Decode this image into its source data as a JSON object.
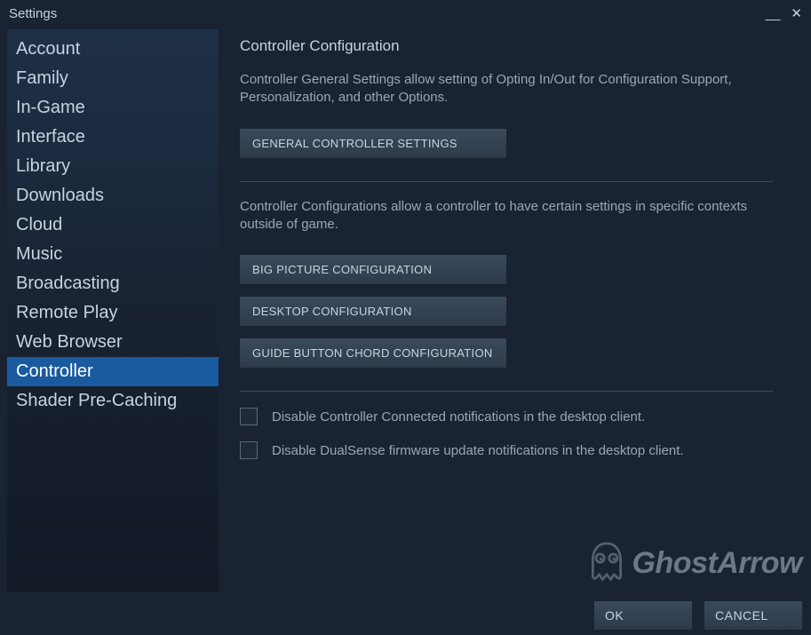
{
  "window": {
    "title": "Settings"
  },
  "sidebar": {
    "items": [
      {
        "label": "Account",
        "active": false
      },
      {
        "label": "Family",
        "active": false
      },
      {
        "label": "In-Game",
        "active": false
      },
      {
        "label": "Interface",
        "active": false
      },
      {
        "label": "Library",
        "active": false
      },
      {
        "label": "Downloads",
        "active": false
      },
      {
        "label": "Cloud",
        "active": false
      },
      {
        "label": "Music",
        "active": false
      },
      {
        "label": "Broadcasting",
        "active": false
      },
      {
        "label": "Remote Play",
        "active": false
      },
      {
        "label": "Web Browser",
        "active": false
      },
      {
        "label": "Controller",
        "active": true
      },
      {
        "label": "Shader Pre-Caching",
        "active": false
      }
    ]
  },
  "content": {
    "title": "Controller Configuration",
    "desc1": "Controller General Settings allow setting of Opting In/Out for Configuration Support, Personalization, and other Options.",
    "btn_general": "GENERAL CONTROLLER SETTINGS",
    "desc2": "Controller Configurations allow a controller to have certain settings in specific contexts outside of game.",
    "btn_bigpicture": "BIG PICTURE CONFIGURATION",
    "btn_desktop": "DESKTOP CONFIGURATION",
    "btn_guide": "GUIDE BUTTON CHORD CONFIGURATION",
    "cb1_label": "Disable Controller Connected notifications in the desktop client.",
    "cb2_label": "Disable DualSense firmware update notifications in the desktop client."
  },
  "footer": {
    "ok": "OK",
    "cancel": "CANCEL"
  },
  "watermark": {
    "text": "GhostArrow"
  }
}
